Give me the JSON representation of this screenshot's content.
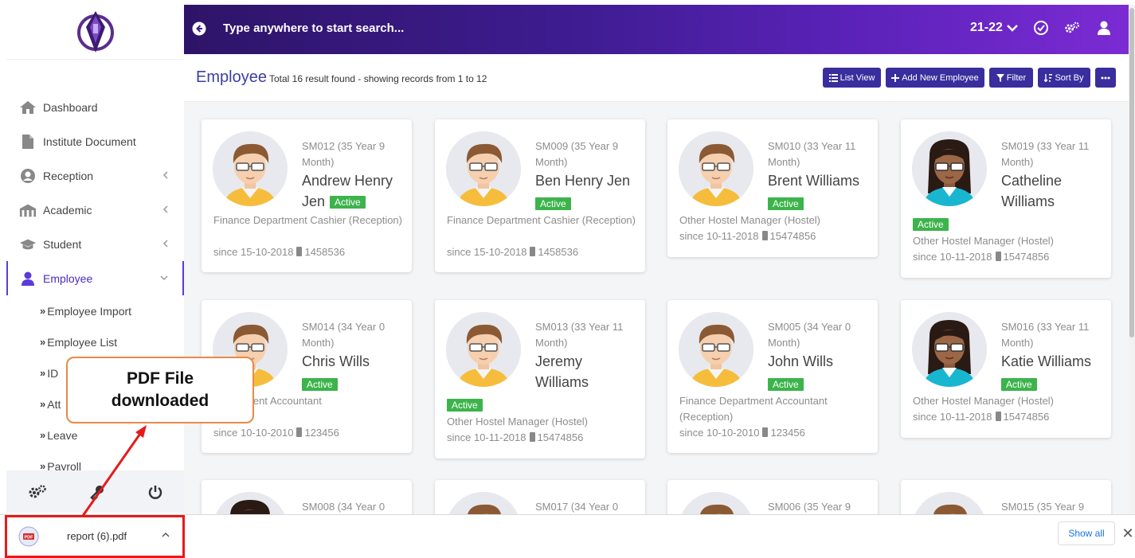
{
  "colors": {
    "accent": "#3a2e9e",
    "active_badge": "#3cb44b",
    "header_start": "#2e1468",
    "header_end": "#7b2bd3",
    "callout_border": "#e88a46",
    "highlight_red": "#e51b1b"
  },
  "header": {
    "search_text": "Type anywhere to start search...",
    "academic_year": "21-22"
  },
  "sidebar": {
    "items": [
      {
        "label": "Dashboard",
        "icon": "home-icon"
      },
      {
        "label": "Institute Document",
        "icon": "document-icon"
      },
      {
        "label": "Reception",
        "icon": "user-circle-icon"
      },
      {
        "label": "Academic",
        "icon": "building-icon"
      },
      {
        "label": "Student",
        "icon": "graduation-cap-icon"
      },
      {
        "label": "Employee",
        "icon": "employee-icon"
      }
    ],
    "subitems": [
      {
        "label": "Employee Import"
      },
      {
        "label": "Employee List"
      },
      {
        "label": "ID"
      },
      {
        "label": "Att"
      },
      {
        "label": "Leave"
      },
      {
        "label": "Payroll"
      }
    ]
  },
  "page": {
    "title": "Employee",
    "result_text": "Total 16 result found - showing records from 1 to 12"
  },
  "toolbar": {
    "list_view": "List View",
    "add_new": "Add New Employee",
    "filter": "Filter",
    "sort_by": "Sort By"
  },
  "employees": [
    {
      "code": "SM012 (35 Year 9 Month)",
      "name1": "Andrew Henry",
      "name2": "Jen",
      "status": "Active",
      "dept": "Finance Department Cashier (Reception)",
      "since": "since 15-10-2018",
      "phone": "1458536"
    },
    {
      "code": "SM009 (35 Year 9 Month)",
      "name1": "Ben Henry Jen",
      "status": "Active",
      "dept": "Finance Department Cashier (Reception)",
      "since": "since 15-10-2018",
      "phone": "1458536"
    },
    {
      "code": "SM010 (33 Year 11 Month)",
      "name1": "Brent Williams",
      "status": "Active",
      "dept": "Other Hostel Manager (Hostel)",
      "since": "since 10-11-2018",
      "phone": "15474856"
    },
    {
      "code": "SM019 (33 Year 11 Month)",
      "name1": "Catheline",
      "name2": "Williams",
      "status": "Active",
      "dept": "Other Hostel Manager (Hostel)",
      "since": "since 10-11-2018",
      "phone": "15474856"
    },
    {
      "code": "SM014 (34 Year 0 Month)",
      "name1": "Chris Wills",
      "status": "Active",
      "dept": "Department Accountant",
      "dept2": "on)",
      "since": "since 10-10-2010",
      "phone": "123456"
    },
    {
      "code": "SM013 (33 Year 11 Month)",
      "name1": "Jeremy",
      "name2": "Williams",
      "status": "Active",
      "dept": "Other Hostel Manager (Hostel)",
      "since": "since 10-11-2018",
      "phone": "15474856"
    },
    {
      "code": "SM005 (34 Year 0 Month)",
      "name1": "John Wills",
      "status": "Active",
      "dept": "Finance Department Accountant (Reception)",
      "since": "since 10-10-2010",
      "phone": "123456"
    },
    {
      "code": "SM016 (33 Year 11 Month)",
      "name1": "Katie Williams",
      "status": "Active",
      "dept": "Other Hostel Manager (Hostel)",
      "since": "since 10-11-2018",
      "phone": "15474856"
    },
    {
      "code": "SM008 (34 Year 0"
    },
    {
      "code": "SM017 (34 Year 0"
    },
    {
      "code": "SM006 (35 Year 9"
    },
    {
      "code": "SM015 (35 Year 9"
    }
  ],
  "download": {
    "file_name": "report (6).pdf",
    "file_icon_text": "PDF",
    "show_all": "Show all"
  },
  "callout": {
    "text": "PDF File\ndownloaded"
  }
}
